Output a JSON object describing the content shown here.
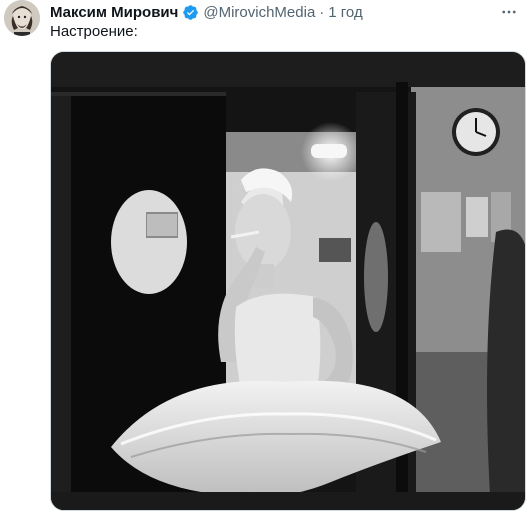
{
  "tweet": {
    "author_name": "Максим Мирович",
    "handle": "@MirovichMedia",
    "separator": "·",
    "time": "1 год",
    "text": "Настроение:",
    "verified": true
  },
  "icons": {
    "verified": "verified-badge-icon",
    "more": "more-options-icon"
  },
  "colors": {
    "verified": "#1d9bf0",
    "muted_text": "#536471",
    "text": "#0f1419"
  },
  "photo": {
    "kind": "black-and-white photograph: ballerina in white tutu smoking backstage"
  }
}
